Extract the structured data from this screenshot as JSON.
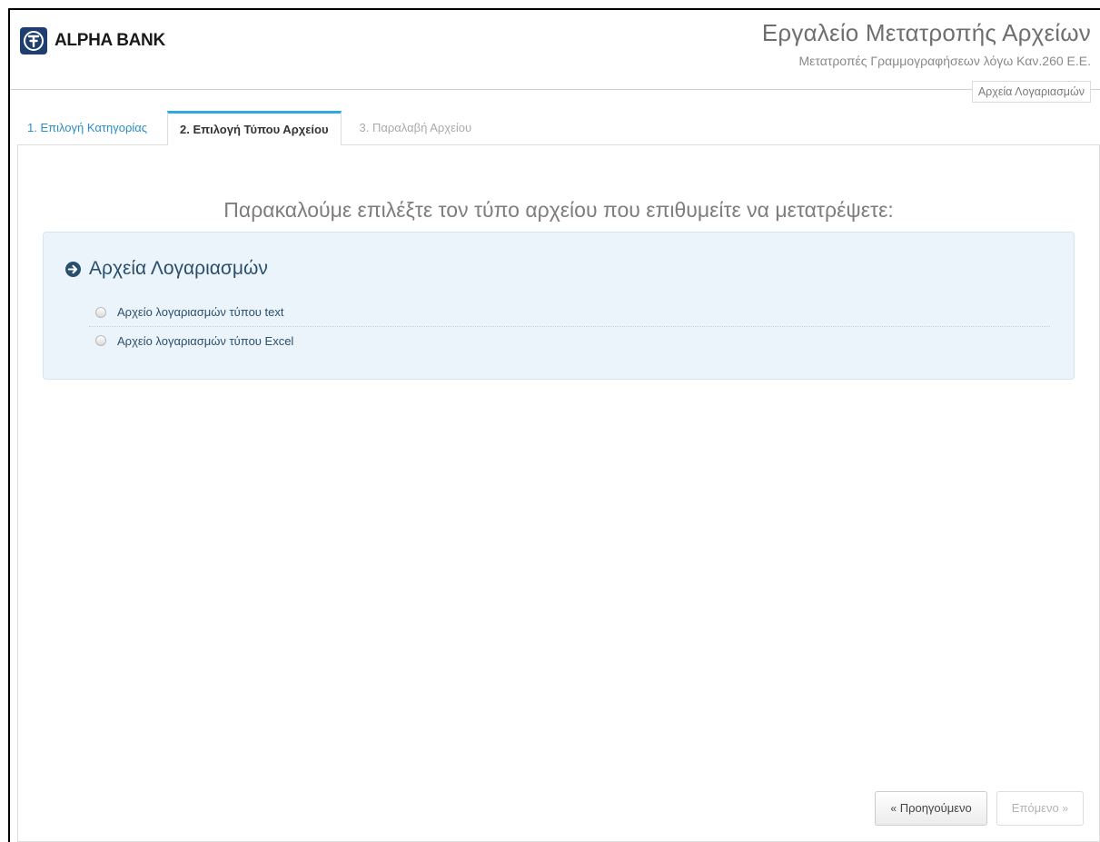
{
  "header": {
    "logo_text": "ALPHA BANK",
    "logo_icon": "alpha-bank-logo-icon",
    "title": "Εργαλείο Μετατροπής Αρχείων",
    "subtitle": "Μετατροπές Γραμμογραφήσεων λόγω Καν.260 Ε.Ε.",
    "badge": "Αρχεία Λογαριασμών"
  },
  "tabs": [
    {
      "label": "1. Επιλογή Κατηγορίας",
      "state": "completed"
    },
    {
      "label": "2. Επιλογή Τύπου Αρχείου",
      "state": "active"
    },
    {
      "label": "3. Παραλαβή Αρχείου",
      "state": "disabled"
    }
  ],
  "main": {
    "instruction": "Παρακαλούμε επιλέξτε τον τύπο αρχείου που επιθυμείτε να μετατρέψετε:",
    "category": {
      "icon": "arrow-circle-right-icon",
      "title": "Αρχεία Λογαριασμών",
      "options": [
        {
          "label": "Αρχείο λογαριασμών τύπου text",
          "checked": false
        },
        {
          "label": "Αρχείο λογαριασμών τύπου Excel",
          "checked": false
        }
      ]
    }
  },
  "buttons": {
    "prev_label": "Προηγούμενο",
    "prev_icon": "«",
    "next_label": "Επόμενο",
    "next_icon": "»"
  },
  "colors": {
    "accent": "#2eaadc",
    "link": "#2b8fc4",
    "logo": "#1d3e6e",
    "category_bg": "#ebf4fa",
    "category_text": "#2a4f6d"
  }
}
